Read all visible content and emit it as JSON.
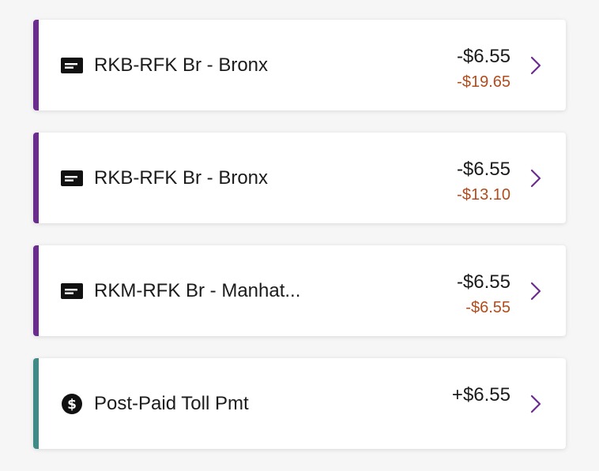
{
  "transactions": [
    {
      "icon": "toll-tag-icon",
      "title": "RKB-RFK Br - Bronx",
      "amount": "-$6.55",
      "balance": "-$19.65",
      "accent_color": "#6b2c8f"
    },
    {
      "icon": "toll-tag-icon",
      "title": "RKB-RFK Br - Bronx",
      "amount": "-$6.55",
      "balance": "-$13.10",
      "accent_color": "#6b2c8f"
    },
    {
      "icon": "toll-tag-icon",
      "title": "RKM-RFK Br - Manhat...",
      "amount": "-$6.55",
      "balance": "-$6.55",
      "accent_color": "#6b2c8f"
    },
    {
      "icon": "dollar-circle-icon",
      "title": "Post-Paid Toll Pmt",
      "amount": "+$6.55",
      "accent_color": "#3f8b88"
    }
  ],
  "colors": {
    "chevron": "#6b2c8f",
    "balance_text": "#b24b1c"
  }
}
